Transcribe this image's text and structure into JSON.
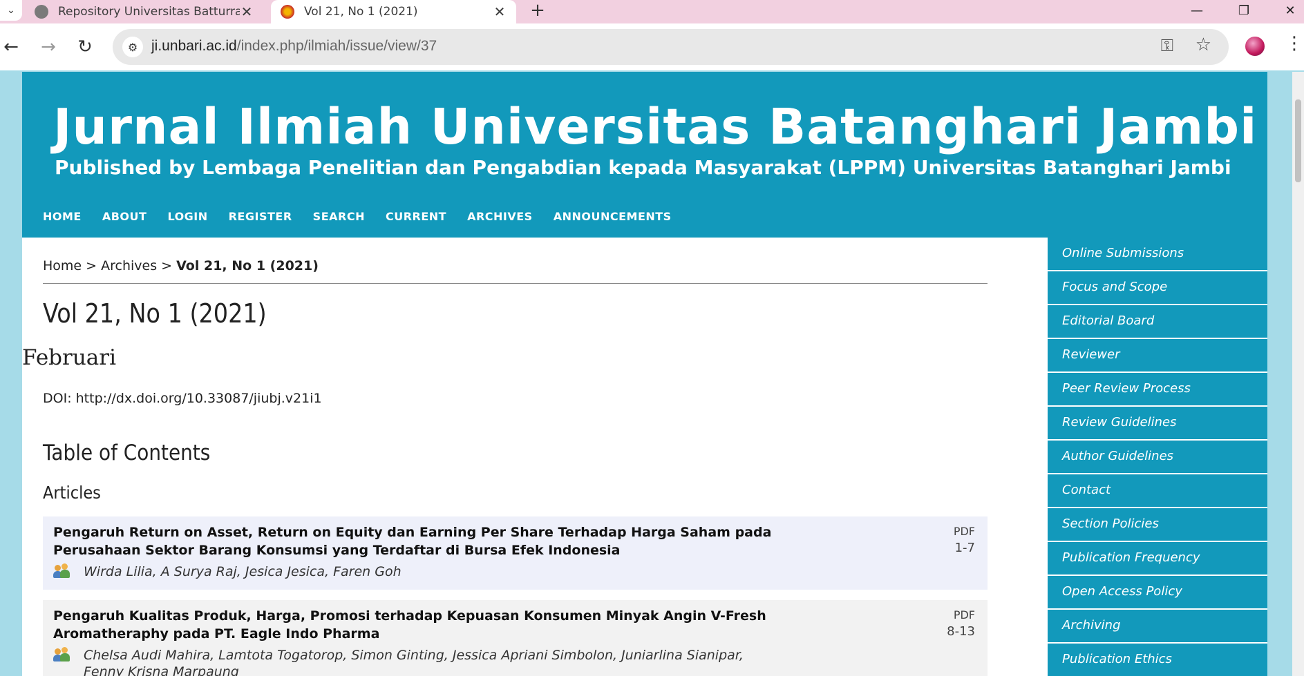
{
  "browser": {
    "tabs": [
      {
        "title": "Repository Universitas Batturran",
        "active": false
      },
      {
        "title": "Vol 21, No 1 (2021)",
        "active": true
      }
    ],
    "url_domain": "ji.unbari.ac.id",
    "url_path": "/index.php/ilmiah/issue/view/37"
  },
  "site": {
    "title": "Jurnal Ilmiah Universitas Batanghari Jambi",
    "subtitle": "Published by Lembaga Penelitian dan Pengabdian kepada Masyarakat (LPPM) Universitas Batanghari Jambi",
    "nav": [
      "HOME",
      "ABOUT",
      "LOGIN",
      "REGISTER",
      "SEARCH",
      "CURRENT",
      "ARCHIVES",
      "ANNOUNCEMENTS"
    ],
    "accent": "#1299bb"
  },
  "breadcrumb": {
    "home": "Home",
    "sep1": ">",
    "archives": "Archives",
    "sep2": ">",
    "current": "Vol 21, No 1 (2021)"
  },
  "issue": {
    "title": "Vol 21, No 1 (2021)",
    "subtitle": "Februari",
    "doi": "DOI: http://dx.doi.org/10.33087/jiubj.v21i1"
  },
  "toc": {
    "title": "Table of Contents",
    "section": "Articles",
    "articles": [
      {
        "title": "Pengaruh Return on Asset, Return on Equity dan Earning Per Share Terhadap Harga Saham pada Perusahaan Sektor Barang Konsumsi yang Terdaftar di Bursa Efek Indonesia",
        "authors": "Wirda Lilia, A Surya Raj, Jesica Jesica, Faren Goh",
        "galley": "PDF",
        "pages": "1-7"
      },
      {
        "title": "Pengaruh Kualitas Produk, Harga, Promosi terhadap Kepuasan Konsumen Minyak Angin V-Fresh Aromatheraphy pada PT. Eagle Indo Pharma",
        "authors": "Chelsa Audi Mahira, Lamtota Togatorop, Simon Ginting, Jessica Apriani Simbolon, Juniarlina Sianipar, Fenny Krisna Marpaung",
        "galley": "PDF",
        "pages": "8-13"
      }
    ]
  },
  "sidebar": {
    "items": [
      "Online Submissions",
      "Focus and Scope",
      "Editorial Board",
      "Reviewer",
      "Peer Review Process",
      "Review Guidelines",
      "Author Guidelines",
      "Contact",
      "Section Policies",
      "Publication Frequency",
      "Open Access Policy",
      "Archiving",
      "Publication Ethics"
    ]
  }
}
